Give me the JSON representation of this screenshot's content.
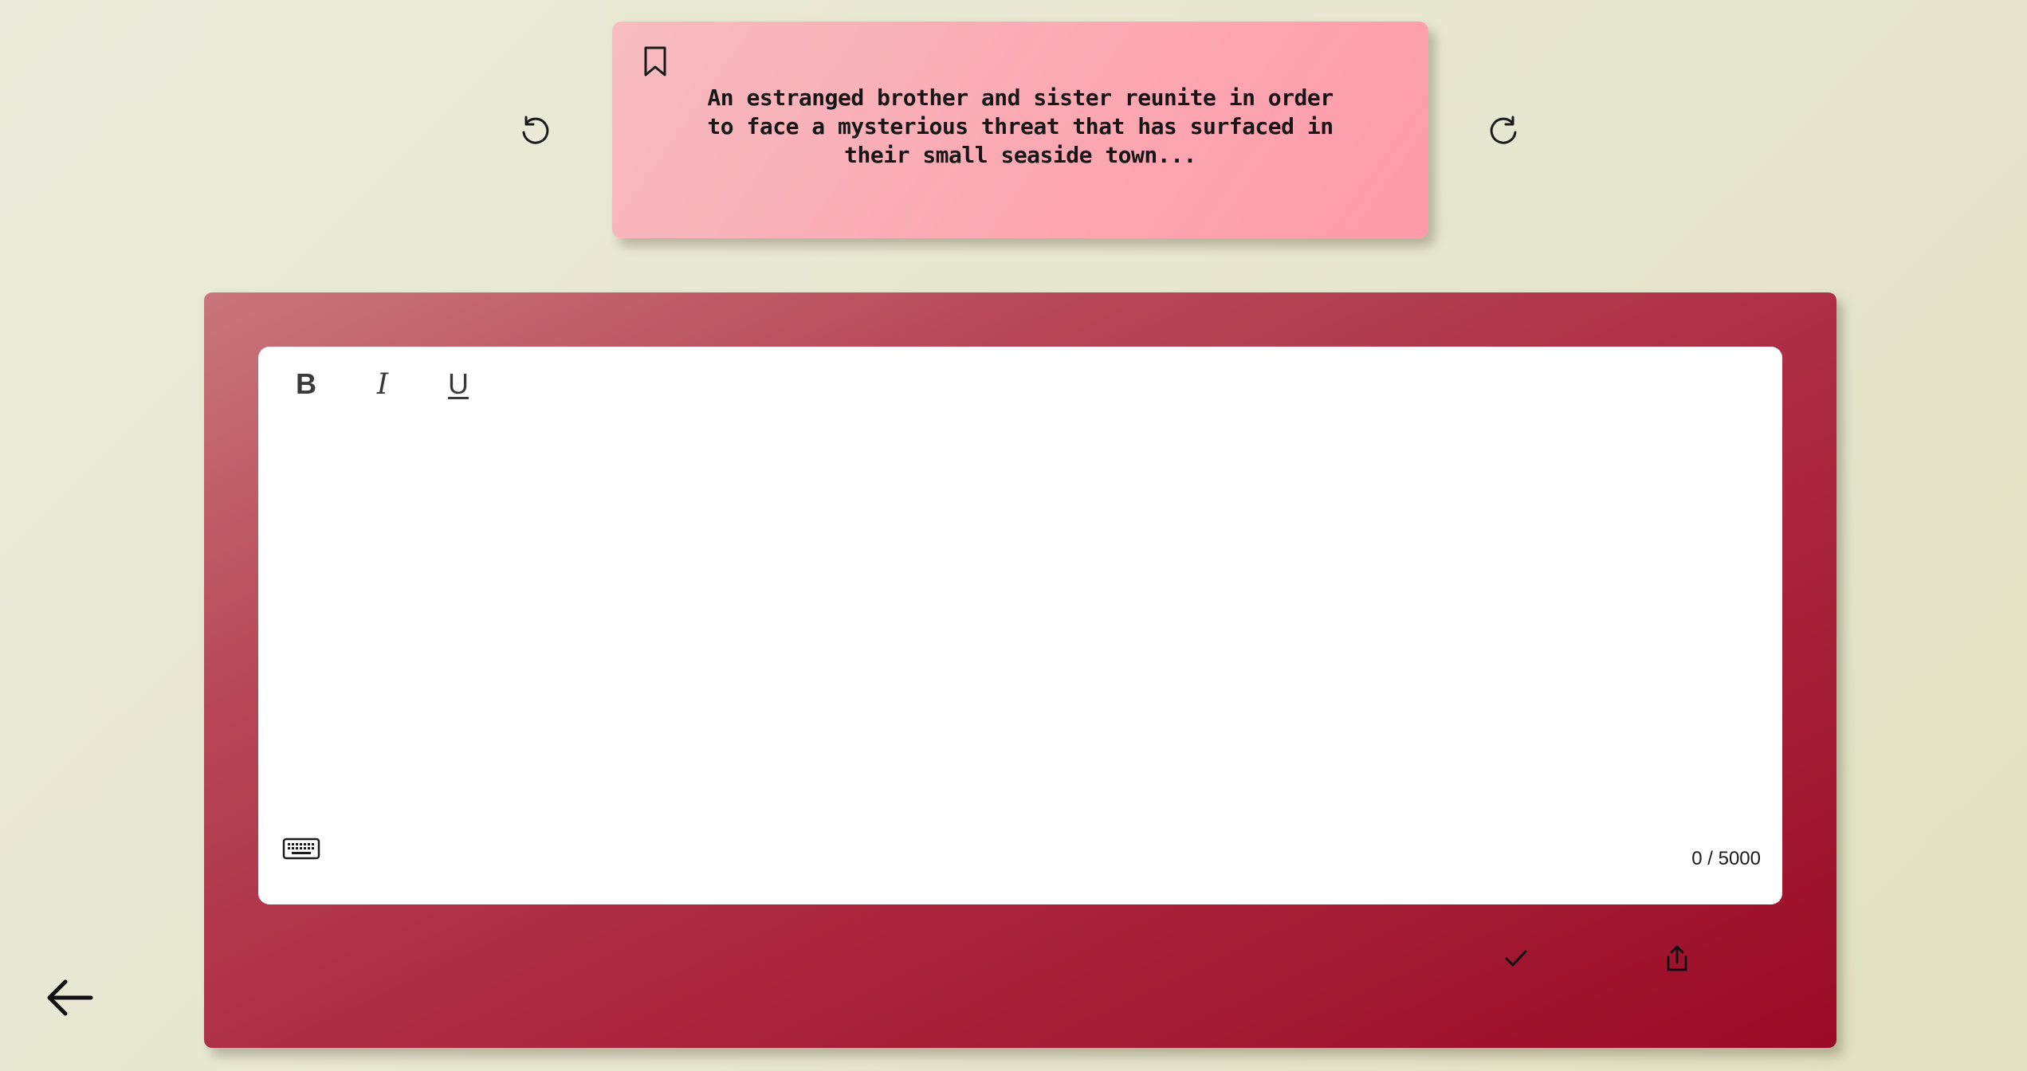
{
  "prompt": {
    "text": "An estranged brother and sister reunite in order to face a mysterious threat that has surfaced in their small seaside town...",
    "bookmark_icon": "bookmark-icon",
    "card_colors": [
      "#f7bcc0",
      "#fe9aaa"
    ]
  },
  "navigation": {
    "previous_icon": "rotate-ccw-icon",
    "next_icon": "rotate-cw-icon",
    "back_icon": "arrow-left-icon"
  },
  "editor": {
    "toolbar": {
      "bold_label": "B",
      "italic_label": "I",
      "underline_label": "U"
    },
    "content": "",
    "keyboard_icon": "keyboard-icon",
    "char_count": "0 / 5000"
  },
  "actions": {
    "submit_icon": "check-icon",
    "share_icon": "share-icon"
  },
  "colors": {
    "background": "#e8e7d3",
    "panel_accent": "#a21a33"
  }
}
